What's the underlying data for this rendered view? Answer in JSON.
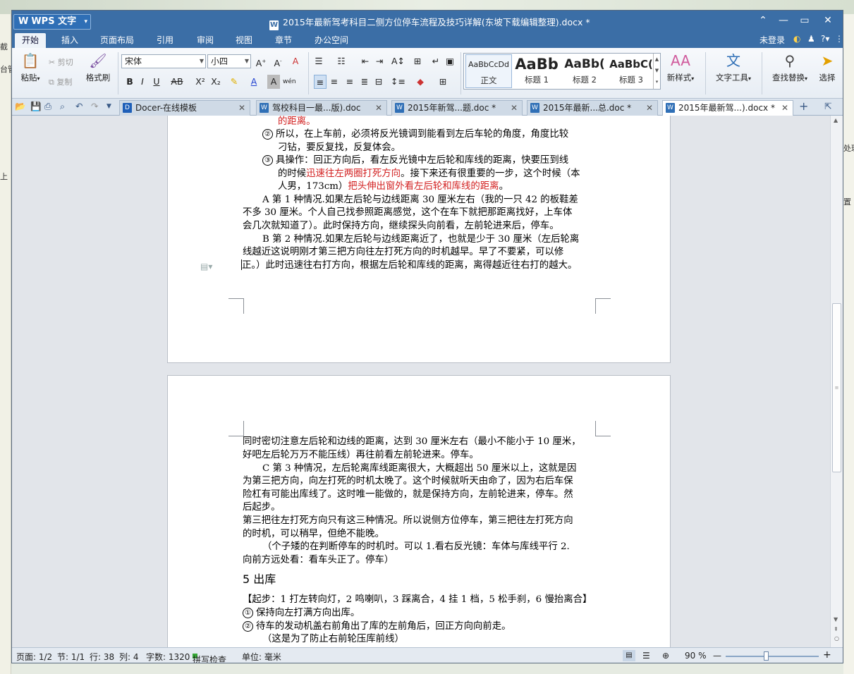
{
  "background": {
    "left_fragments": [
      "截",
      "台管",
      "上"
    ],
    "right_fragments": [
      "处理",
      "置"
    ]
  },
  "window": {
    "app_button": "WPS 文字",
    "title": "2015年最新驾考科目二侧方位停车流程及技巧详解(东坡下载编辑整理).docx *"
  },
  "menu": {
    "tabs": [
      "开始",
      "插入",
      "页面布局",
      "引用",
      "审阅",
      "视图",
      "章节",
      "办公空间"
    ],
    "active_tab": "开始",
    "login": "未登录"
  },
  "ribbon": {
    "paste": "粘贴",
    "cut": "剪切",
    "copy": "复制",
    "format_painter": "格式刷",
    "font_name": "宋体",
    "font_size": "小四",
    "styles": [
      {
        "preview": "AaBbCcDd",
        "name": "正文"
      },
      {
        "preview": "AaBb",
        "name": "标题 1"
      },
      {
        "preview": "AaBb(",
        "name": "标题 2"
      },
      {
        "preview": "AaBbC(",
        "name": "标题 3"
      }
    ],
    "new_style": "新样式",
    "text_tools": "文字工具",
    "find_replace": "查找替换",
    "select": "选择"
  },
  "tabs": [
    {
      "label": "Docer-在线模板",
      "active": false
    },
    {
      "label": "驾校科目一最...版).doc",
      "active": false
    },
    {
      "label": "2015年新驾...题.doc *",
      "active": false
    },
    {
      "label": "2015年最新...总.doc *",
      "active": false
    },
    {
      "label": "2015年最新驾...).docx *",
      "active": true
    }
  ],
  "page1": {
    "line0": "的距离。",
    "item2_num": "②",
    "item2_l1": "所以，在上车前，必须将反光镜调到能看到左后车轮的角度，角度比较",
    "item2_l2": "刁钻，要反复找，反复体会。",
    "item3_num": "③",
    "item3_l1": "具操作：回正方向后，看左反光镜中左后轮和库线的距离，快要压到线",
    "item3_l2a": "的时候",
    "item3_l2b": "迅速往左两圈打死方向",
    "item3_l2c": "。接下来还有很重要的一步，这个时候（本",
    "item3_l3a": "人男，173cm）",
    "item3_l3b": "把头伸出窗外看左后轮和库线的距离",
    "item3_l3c": "。",
    "a_l1": "A 第 1 种情况.如果左后轮与边线距离 30 厘米左右（我的一只 42 的板鞋差",
    "a_l2": "不多 30 厘米。个人自己找参照距离感觉，这个在车下就把那距离找好，上车体",
    "a_l3": "会几次就知道了）。此时保持方向，继续探头向前看，左前轮进来后，停车。",
    "b_l1": "B 第 2 种情况.如果左后轮与边线距离近了，也就是少于 30 厘米（左后轮离",
    "b_l2": "线越近这说明刚才第三把方向往左打死方向的时机越早。早了不要紧，可以修",
    "b_l3": "正。）此时迅速往右打方向，根据左后轮和库线的距离，离得越近往右打的越大。"
  },
  "page2": {
    "l1": "同时密切注意左后轮和边线的距离，达到 30 厘米左右（最小不能小于 10 厘米，",
    "l2": "好吧左后轮万万不能压线）再往前看左前轮进来。停车。",
    "c_l1": "C 第 3 种情况，左后轮离库线距离很大，大概超出 50 厘米以上，这就是因",
    "c_l2": "为第三把方向，向左打死的时机太晚了。这个时候就听天由命了，因为右后车保",
    "c_l3": "险杠有可能出库线了。这时唯一能做的，就是保持方向，左前轮进来，停车。然",
    "c_l4": "后起步。",
    "d_l1": "第三把往左打死方向只有这三种情况。所以说侧方位停车，第三把往左打死方向",
    "d_l2": "的时机，可以稍早，但绝不能晚。",
    "e_l1": "（个子矮的在判断停车的时机时。可以 1.看右反光镜：车体与库线平行 2.",
    "e_l2": "向前方远处看：看车头正了。停车）",
    "heading": "5 出库",
    "step": "【起步：1 打左转向灯，2 鸣喇叭，3 踩离合，4 挂 1 档，5 松手刹，6 慢抬离合】",
    "i1_num": "①",
    "i1": "保持向左打满方向出库。",
    "i2_num": "②",
    "i2": "待车的发动机盖右前角出了库的左前角后，回正方向向前走。",
    "i3": "（这是为了防止右前轮压库前线）"
  },
  "status": {
    "page": "页面: 1/2",
    "section": "节: 1/1",
    "row": "行: 38",
    "col": "列: 4",
    "words": "字数: 1320",
    "spell": "拼写检查",
    "unit": "单位: 毫米",
    "zoom": "90 %"
  },
  "zoom_level": 0.9
}
